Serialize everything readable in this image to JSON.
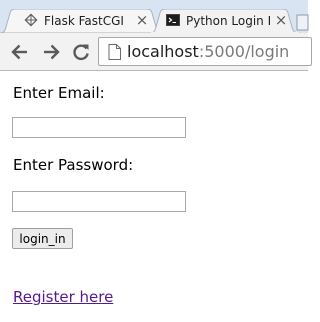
{
  "browser": {
    "tabs": [
      {
        "title": "Flask FastCGI",
        "close_glyph": "×",
        "icon": "diamond-grid-icon",
        "active": false
      },
      {
        "title": "Python Login Pa",
        "close_glyph": "×",
        "icon": "terminal-icon",
        "active": true
      }
    ],
    "address_bar": {
      "host": "localhost",
      "path": ":5000/login",
      "icon": "page-icon"
    },
    "nav_icons": [
      "back-arrow-icon",
      "forward-arrow-icon",
      "reload-icon"
    ]
  },
  "page": {
    "email_label": "Enter Email:",
    "email_value": "",
    "password_label": "Enter Password:",
    "password_value": "",
    "login_button": "login_in",
    "register_link": "Register here"
  },
  "colors": {
    "tabstrip_bg": "#d9e4f2",
    "toolbar_bg": "#f2f2f2",
    "visited_link": "#551a8b"
  }
}
